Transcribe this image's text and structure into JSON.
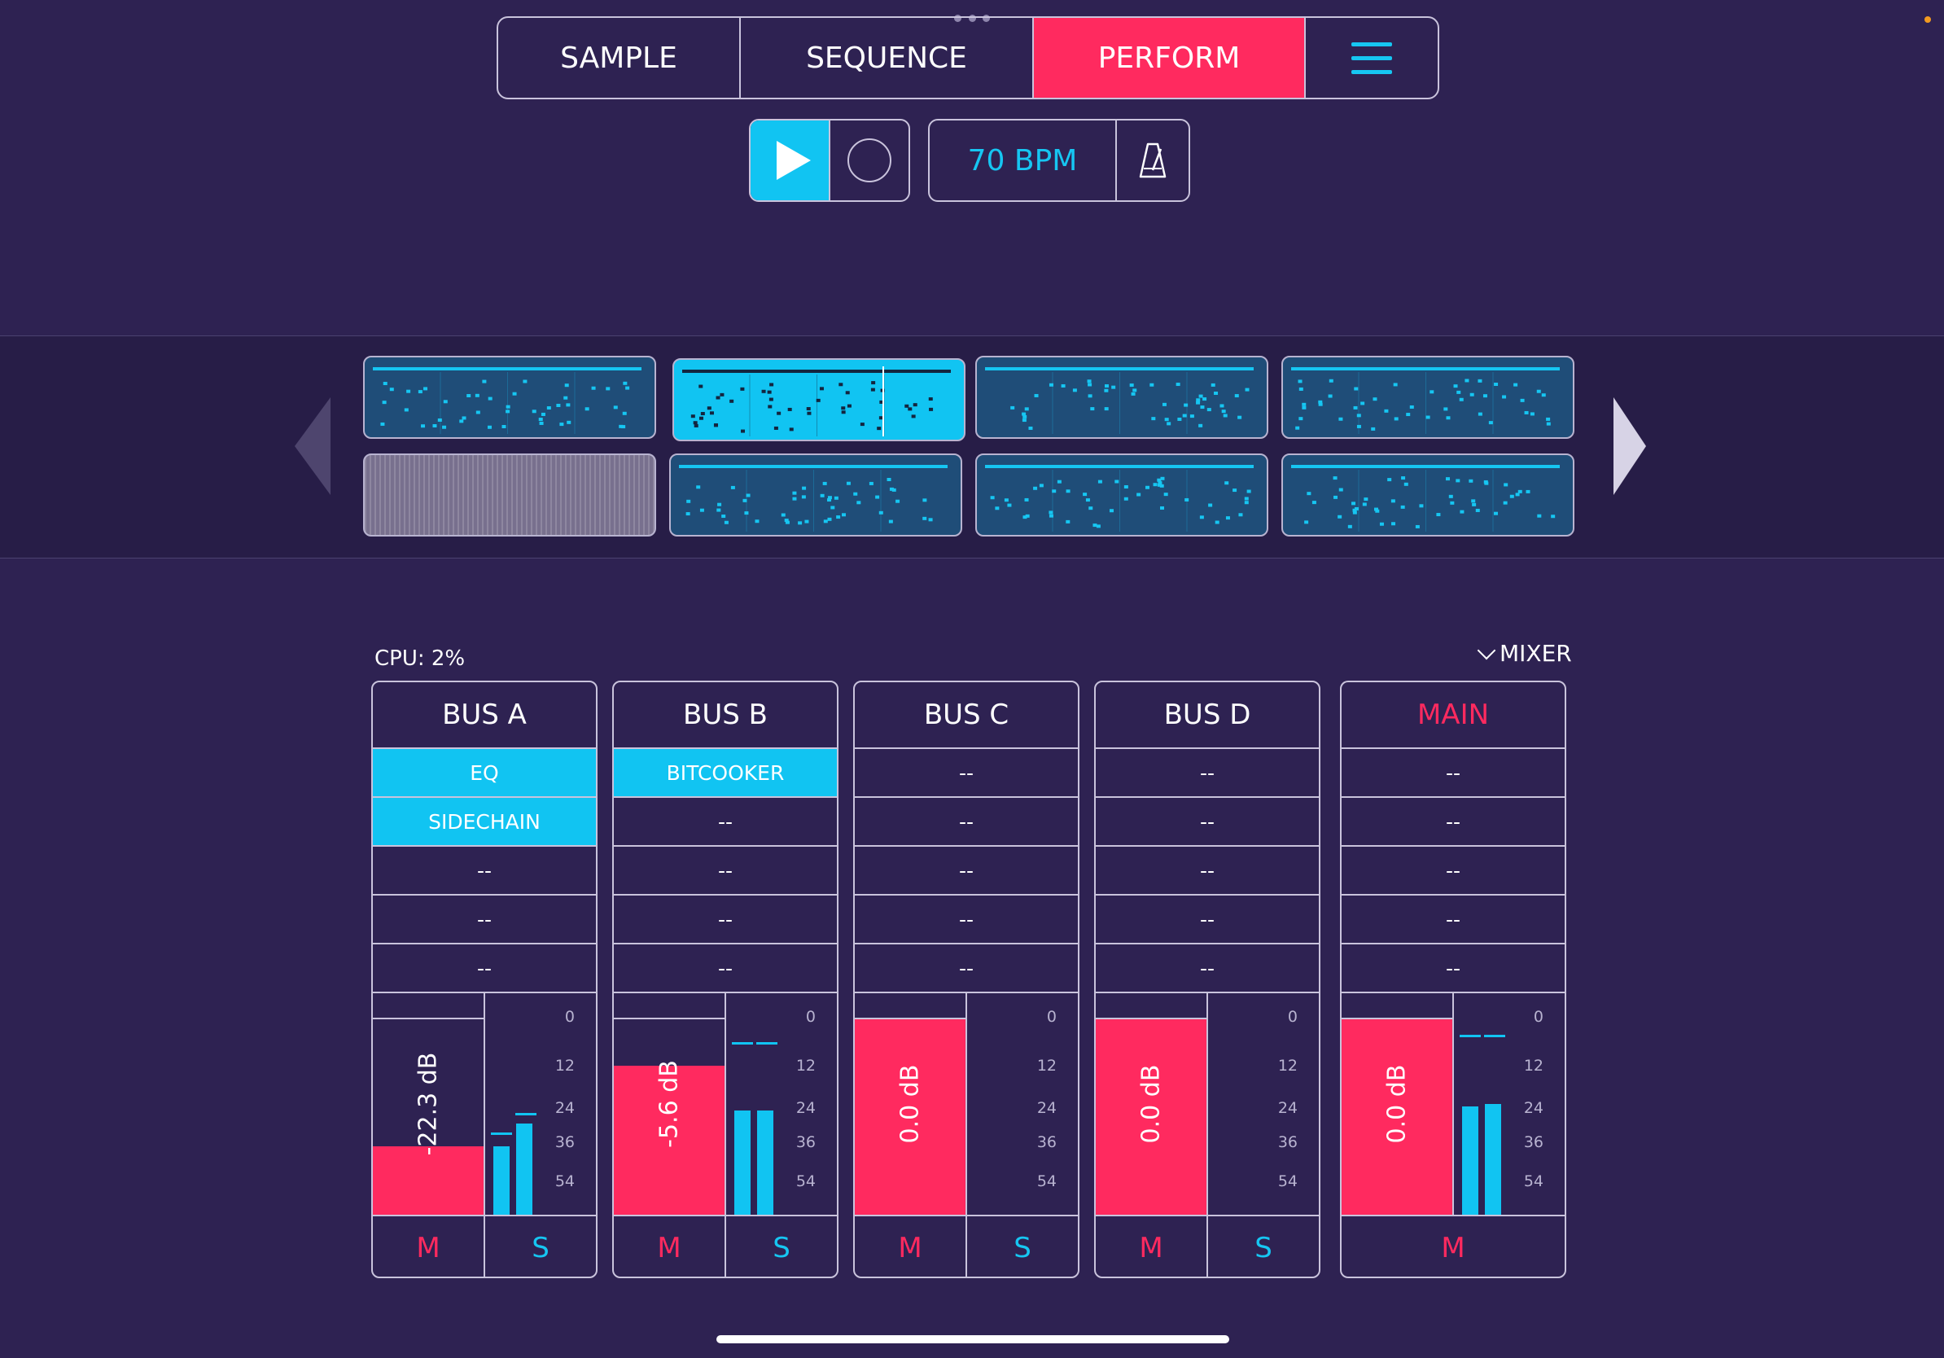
{
  "tabs": [
    {
      "label": "SAMPLE",
      "active": false
    },
    {
      "label": "SEQUENCE",
      "active": false
    },
    {
      "label": "PERFORM",
      "active": true
    }
  ],
  "transport": {
    "tempo": "70 BPM"
  },
  "cpu": "CPU: 2%",
  "mixer_toggle": "MIXER",
  "colors": {
    "accent": "#ff2a5f",
    "cyan": "#11c4f2",
    "background": "#2e2252"
  },
  "channels": [
    {
      "name": "BUS A",
      "slots": [
        "EQ",
        "SIDECHAIN",
        "--",
        "--",
        "--"
      ],
      "active_slots": [
        0,
        1
      ],
      "db": "-22.3 dB",
      "fader_level": 0.57,
      "meter_levels": [
        0.31,
        0.41
      ],
      "peak_levels": [
        0.36,
        0.45
      ],
      "mute": "M",
      "solo": "S"
    },
    {
      "name": "BUS B",
      "slots": [
        "BITCOOKER",
        "--",
        "--",
        "--",
        "--"
      ],
      "active_slots": [
        0
      ],
      "db": "-5.6 dB",
      "fader_level": 0.88,
      "meter_levels": [
        0.47,
        0.47
      ],
      "peak_levels": [
        0.77,
        0.77
      ],
      "mute": "M",
      "solo": "S"
    },
    {
      "name": "BUS C",
      "slots": [
        "--",
        "--",
        "--",
        "--",
        "--"
      ],
      "active_slots": [],
      "db": "0.0 dB",
      "fader_level": 1.0,
      "meter_levels": [
        0,
        0
      ],
      "peak_levels": [],
      "mute": "M",
      "solo": "S"
    },
    {
      "name": "BUS D",
      "slots": [
        "--",
        "--",
        "--",
        "--",
        "--"
      ],
      "active_slots": [],
      "db": "0.0 dB",
      "fader_level": 1.0,
      "meter_levels": [
        0,
        0
      ],
      "peak_levels": [],
      "mute": "M",
      "solo": "S"
    },
    {
      "name": "MAIN",
      "slots": [
        "--",
        "--",
        "--",
        "--",
        "--"
      ],
      "active_slots": [],
      "db": "0.0 dB",
      "fader_level": 1.0,
      "meter_levels": [
        0.49,
        0.5
      ],
      "peak_levels": [
        0.8,
        0.8
      ],
      "mute": "M",
      "solo": ""
    }
  ],
  "meter_scale": [
    "0",
    "12",
    "24",
    "36",
    "54"
  ],
  "patterns": [
    {
      "state": "normal"
    },
    {
      "state": "selected"
    },
    {
      "state": "normal"
    },
    {
      "state": "normal"
    },
    {
      "state": "empty"
    },
    {
      "state": "normal"
    },
    {
      "state": "normal"
    },
    {
      "state": "normal"
    }
  ],
  "icons": {
    "menu": "hamburger-icon",
    "play": "play-icon",
    "record": "record-icon",
    "metronome": "metronome-icon",
    "prev": "chevron-left-icon",
    "next": "chevron-right-icon"
  }
}
